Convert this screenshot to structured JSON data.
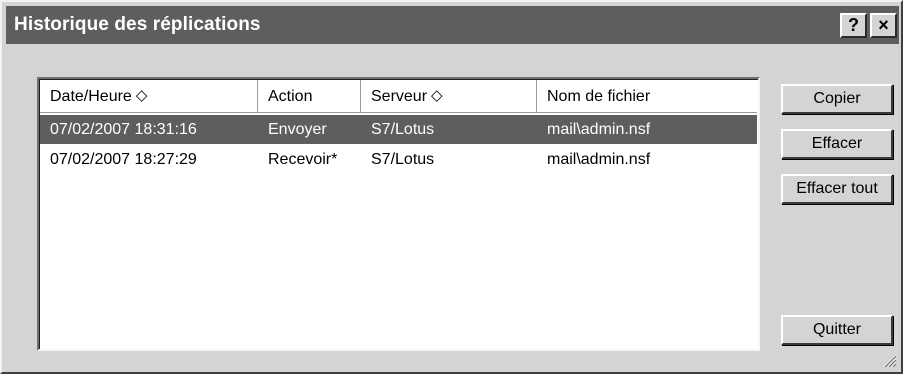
{
  "window": {
    "title": "Historique des réplications",
    "help_label": "?",
    "close_label": "×"
  },
  "list": {
    "columns": [
      {
        "label": "Date/Heure",
        "sortable": true
      },
      {
        "label": "Action",
        "sortable": false
      },
      {
        "label": "Serveur",
        "sortable": true
      },
      {
        "label": "Nom de fichier",
        "sortable": false
      }
    ],
    "sort_glyph": "◇",
    "rows": [
      {
        "datetime": "07/02/2007 18:31:16",
        "action": "Envoyer",
        "server": "S7/Lotus",
        "file": "mail\\admin.nsf",
        "selected": true
      },
      {
        "datetime": "07/02/2007 18:27:29",
        "action": "Recevoir*",
        "server": "S7/Lotus",
        "file": "mail\\admin.nsf",
        "selected": false
      }
    ]
  },
  "buttons": {
    "copy": "Copier",
    "clear": "Effacer",
    "clear_all": "Effacer tout",
    "quit": "Quitter"
  },
  "colors": {
    "titlebar": "#5e5e5e",
    "selection": "#5e5e5e",
    "face": "#d4d4d4"
  }
}
